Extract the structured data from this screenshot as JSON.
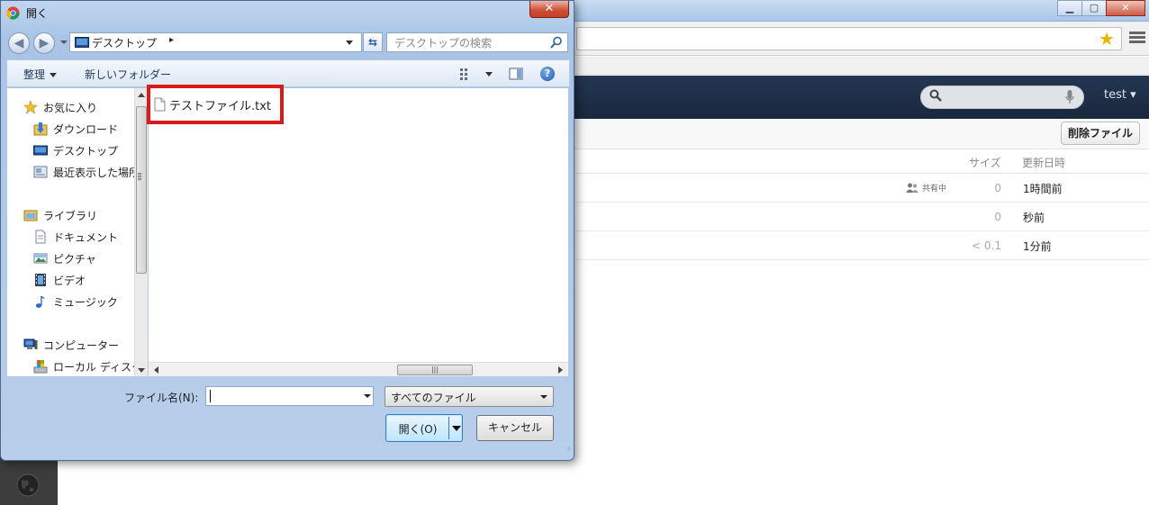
{
  "browser": {
    "tabs": [
      "",
      "",
      ""
    ],
    "window_buttons": {
      "minimize": "▁",
      "maximize": "▢",
      "close": "✕"
    }
  },
  "app": {
    "user_menu": "test ▾",
    "delete_button": "削除ファイル",
    "table": {
      "headers": {
        "size": "サイズ",
        "modified": "更新日時"
      },
      "rows": [
        {
          "shared": "共有中",
          "size": "0",
          "modified": "1時間前"
        },
        {
          "shared": "",
          "size": "0",
          "modified": "秒前"
        },
        {
          "shared": "",
          "size": "< 0.1",
          "modified": "1分前"
        }
      ]
    }
  },
  "dialog": {
    "title": "開く",
    "close": "✕",
    "address": {
      "location": "デスクトップ",
      "chevron": "▸"
    },
    "search_placeholder": "デスクトップの検索",
    "toolbar": {
      "organize": "整理",
      "new_folder": "新しいフォルダー",
      "help": "?"
    },
    "nav": {
      "favorites": "お気に入り",
      "downloads": "ダウンロード",
      "desktop": "デスクトップ",
      "recent": "最近表示した場所",
      "libraries": "ライブラリ",
      "documents": "ドキュメント",
      "pictures": "ピクチャ",
      "videos": "ビデオ",
      "music": "ミュージック",
      "computer": "コンピューター",
      "local_disk": "ローカル ディスク"
    },
    "files": [
      {
        "name": "テストファイル.txt"
      }
    ],
    "filename_label": "ファイル名(N):",
    "filename_value": "",
    "filetype": "すべてのファイル",
    "open_button": "開く(O)",
    "cancel_button": "キャンセル"
  }
}
